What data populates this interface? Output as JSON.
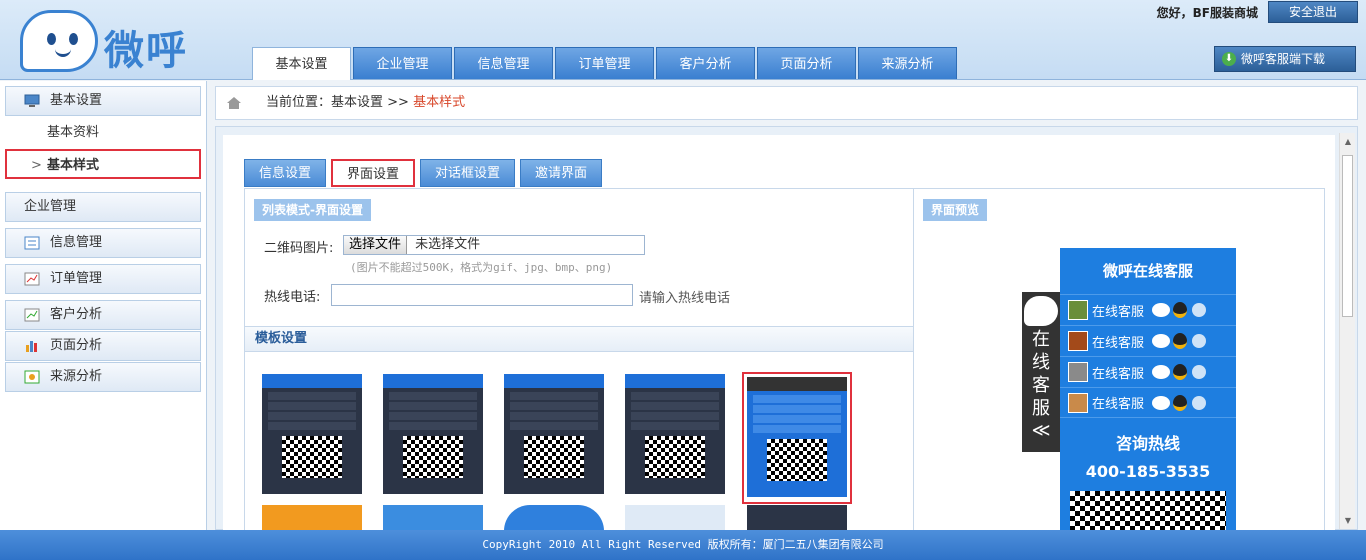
{
  "header": {
    "logo_text": "微呼",
    "greeting": "您好，BF服装商城",
    "logout_label": "安全退出",
    "download_label": "微呼客服端下载",
    "nav": [
      {
        "label": "基本设置",
        "active": true
      },
      {
        "label": "企业管理"
      },
      {
        "label": "信息管理"
      },
      {
        "label": "订单管理"
      },
      {
        "label": "客户分析"
      },
      {
        "label": "页面分析"
      },
      {
        "label": "来源分析"
      }
    ]
  },
  "sidebar": {
    "groups": [
      {
        "label": "基本设置"
      },
      {
        "label": "企业管理"
      },
      {
        "label": "信息管理"
      },
      {
        "label": "订单管理"
      },
      {
        "label": "客户分析"
      },
      {
        "label": "页面分析"
      },
      {
        "label": "来源分析"
      }
    ],
    "subitems": [
      {
        "label": "基本资料"
      },
      {
        "label": "基本样式",
        "active": true,
        "arrow": ">"
      }
    ]
  },
  "breadcrumb": {
    "prefix": "当前位置：基本设置 >>",
    "current": "基本样式"
  },
  "subtabs": [
    {
      "label": "信息设置"
    },
    {
      "label": "界面设置",
      "active": true
    },
    {
      "label": "对话框设置"
    },
    {
      "label": "邀请界面"
    }
  ],
  "form": {
    "section_label": "列表模式-界面设置",
    "qr_label": "二维码图片:",
    "file_button": "选择文件",
    "file_status": "未选择文件",
    "file_hint": "(图片不能超过500K，格式为gif、jpg、bmp、png)",
    "hotline_label": "热线电话:",
    "hotline_value": "",
    "hotline_placeholder": "请输入热线电话",
    "template_title": "模板设置"
  },
  "preview": {
    "label": "界面预览",
    "widget_title": "微呼在线客服",
    "agents": [
      {
        "name": "在线客服"
      },
      {
        "name": "在线客服"
      },
      {
        "name": "在线客服"
      },
      {
        "name": "在线客服"
      }
    ],
    "hotline_title": "咨询热线",
    "hotline_number": "400-185-3535",
    "side_text": [
      "在",
      "线",
      "客",
      "服"
    ],
    "side_chevron": "≪"
  },
  "footer": {
    "copyright": "CopyRight 2010 All Right Reserved 版权所有：厦门二五八集团有限公司"
  },
  "colors": {
    "accent": "#1e7ee0",
    "highlight": "#e0313d",
    "breadcrumb_current": "#d8472a"
  }
}
